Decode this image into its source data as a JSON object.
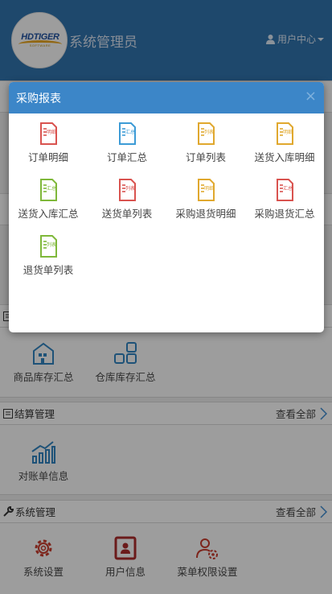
{
  "header": {
    "logo_text": "HDTIGER",
    "logo_sub": "SOFTWARE",
    "title": "系统管理员",
    "user_center": "用户中心"
  },
  "inventory": {
    "items": [
      {
        "label": "商品库存汇总",
        "icon": "warehouse-icon"
      },
      {
        "label": "仓库库存汇总",
        "icon": "grid-icon"
      }
    ]
  },
  "settlement": {
    "title": "结算管理",
    "view_all": "查看全部",
    "items": [
      {
        "label": "对账单信息",
        "icon": "bar-chart-icon"
      }
    ]
  },
  "system": {
    "title": "系统管理",
    "view_all": "查看全部",
    "items": [
      {
        "label": "系统设置",
        "icon": "gear-icon"
      },
      {
        "label": "用户信息",
        "icon": "user-card-icon"
      },
      {
        "label": "菜单权限设置",
        "icon": "user-gear-icon"
      }
    ]
  },
  "modal": {
    "title": "采购报表",
    "close": "×",
    "reports": [
      {
        "label": "订单明细",
        "tag": "明细",
        "color": "#d9534f"
      },
      {
        "label": "订单汇总",
        "tag": "汇总",
        "color": "#3c9bd6"
      },
      {
        "label": "订单列表",
        "tag": "列表",
        "color": "#e0a82e"
      },
      {
        "label": "送货入库明细",
        "tag": "明细",
        "color": "#e0a82e"
      },
      {
        "label": "送货入库汇总",
        "tag": "汇总",
        "color": "#7fb83a"
      },
      {
        "label": "送货单列表",
        "tag": "列表",
        "color": "#d9534f"
      },
      {
        "label": "采购退货明细",
        "tag": "明细",
        "color": "#e0a82e"
      },
      {
        "label": "采购退货汇总",
        "tag": "汇总",
        "color": "#d9534f"
      },
      {
        "label": "退货单列表",
        "tag": "列表",
        "color": "#7fb83a"
      }
    ]
  }
}
